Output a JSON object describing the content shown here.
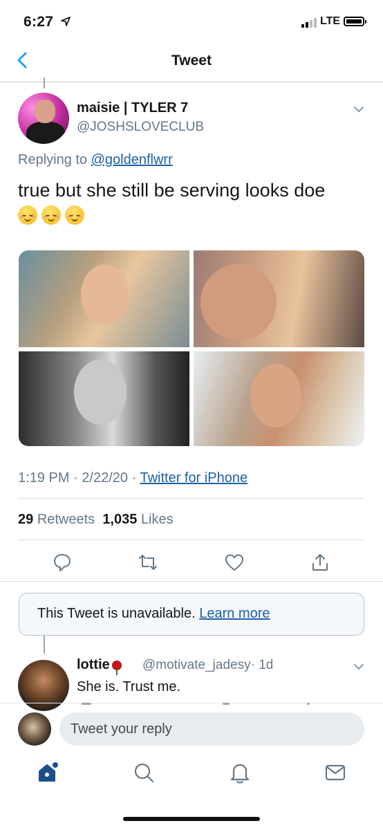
{
  "status_bar": {
    "time": "6:27",
    "network": "LTE",
    "icons": [
      "location-arrow-icon",
      "signal-icon",
      "battery-icon"
    ]
  },
  "nav": {
    "title": "Tweet",
    "back_icon": "chevron-left-icon"
  },
  "tweet": {
    "display_name": "maisie | TYLER 7",
    "handle": "@JOSHSLOVECLUB",
    "replying_prefix": "Replying to",
    "replying_to": "@goldenflwrr",
    "text": "true but she still be serving looks doe",
    "emoji_count": 3,
    "time": "1:19 PM",
    "date": "2/22/20",
    "separator": "·",
    "source": "Twitter for iPhone",
    "retweets_count": "29",
    "retweets_label": "Retweets",
    "likes_count": "1,035",
    "likes_label": "Likes",
    "photos": 4
  },
  "unavailable": {
    "text": "This Tweet is unavailable.",
    "link": "Learn more"
  },
  "reply": {
    "display_name": "lottie",
    "handle": "@motivate_jadesy",
    "age": "· 1d",
    "text": "She is. Trust me."
  },
  "composer": {
    "placeholder": "Tweet your reply"
  },
  "colors": {
    "link": "#1b5fa8",
    "twitter_blue": "#1da1f2",
    "home_tab": "#1b4f8a",
    "muted": "#657786"
  },
  "tab_bar": [
    "home-icon",
    "search-icon",
    "notifications-icon",
    "messages-icon"
  ]
}
